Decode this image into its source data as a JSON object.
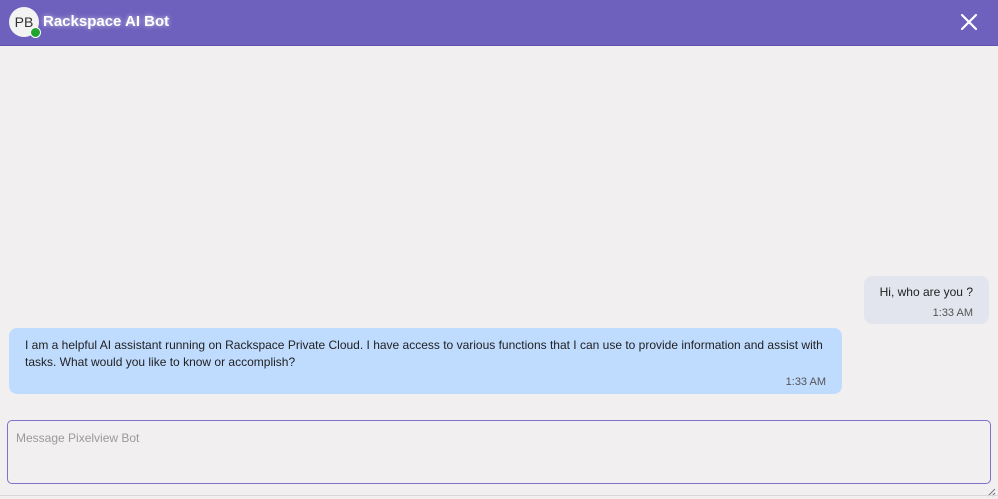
{
  "header": {
    "avatar_initials": "PB",
    "title": "Rackspace AI Bot",
    "status_color": "#1fa42d",
    "accent_color": "#6e61bd",
    "close_icon": "close-icon"
  },
  "messages": [
    {
      "role": "user",
      "text": "Hi, who are you ?",
      "time": "1:33 AM"
    },
    {
      "role": "bot",
      "text": "I am a helpful AI assistant running on Rackspace Private Cloud. I have access to various functions that I can use to provide information and assist with tasks. What would you like to know or accomplish?",
      "time": "1:33 AM"
    }
  ],
  "composer": {
    "placeholder": "Message Pixelview Bot",
    "value": ""
  }
}
